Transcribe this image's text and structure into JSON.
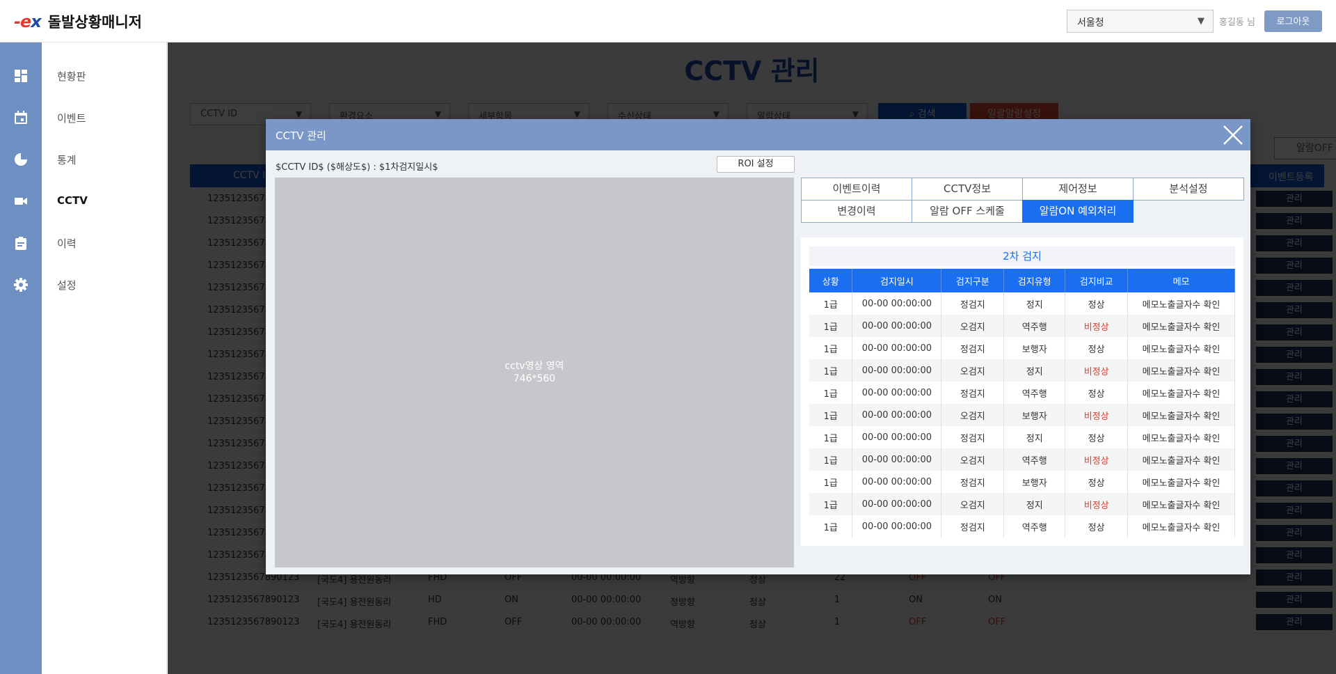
{
  "header": {
    "logo_mark": "ex",
    "app_title": "돌발상황매니저",
    "region_select": "서울청",
    "user_name": "홍길동 님",
    "logout_label": "로그아웃"
  },
  "sidebar": {
    "items": [
      {
        "label": "현황판",
        "icon": "dashboard-icon"
      },
      {
        "label": "이벤트",
        "icon": "calendar-icon"
      },
      {
        "label": "통계",
        "icon": "pie-chart-icon"
      },
      {
        "label": "CCTV",
        "icon": "video-camera-icon",
        "active": true
      },
      {
        "label": "이력",
        "icon": "clipboard-icon"
      },
      {
        "label": "설정",
        "icon": "gear-icon"
      }
    ]
  },
  "background_page": {
    "title": "CCTV 관리",
    "filters": [
      "CCTV ID",
      "환경요소",
      "세부항목",
      "수신상태",
      "알람상태"
    ],
    "search_label": "검색",
    "bulk_alarm_label": "일괄알람설정",
    "schedule_label": "알람OFF 스케줄",
    "table_headers": {
      "first": "CCTV ID",
      "last": "이벤트등록"
    },
    "rows_visible_prefix": "123512356789",
    "manage_label": "관리",
    "bottom_rows": [
      {
        "id": "1235123567890123",
        "location": "[국도4] 용전원동리",
        "res": "FHD",
        "rx": "OFF",
        "time": "00-00 00:00:00",
        "dir": "역방향",
        "status": "정상",
        "count": "22",
        "a1": "OFF",
        "a2": "OFF"
      },
      {
        "id": "1235123567890123",
        "location": "[국도4] 용전원동리",
        "res": "HD",
        "rx": "ON",
        "time": "00-00 00:00:00",
        "dir": "정방향",
        "status": "정상",
        "count": "1",
        "a1": "ON",
        "a2": "ON"
      },
      {
        "id": "1235123567890123",
        "location": "[국도4] 용전원동리",
        "res": "FHD",
        "rx": "OFF",
        "time": "00-00 00:00:00",
        "dir": "역방향",
        "status": "정상",
        "count": "1",
        "a1": "OFF",
        "a2": "OFF"
      }
    ]
  },
  "modal": {
    "title": "CCTV 관리",
    "camera_caption": "$CCTV ID$ ($해상도$) : $1차검지일시$",
    "roi_label": "ROI 설정",
    "video_label_line1": "cctv영상 영역",
    "video_label_line2": "746*560",
    "tabs": [
      {
        "label": "이벤트이력"
      },
      {
        "label": "CCTV정보"
      },
      {
        "label": "제어정보"
      },
      {
        "label": "분석설정"
      },
      {
        "label": "변경이력"
      },
      {
        "label": "알람 OFF 스케줄"
      },
      {
        "label": "알람ON 예외처리",
        "active": true
      }
    ],
    "panel_title": "2차 검지",
    "columns": [
      "상황",
      "검지일시",
      "검지구분",
      "검지유형",
      "검지비교",
      "메모"
    ],
    "rows": [
      [
        "1급",
        "00-00 00:00:00",
        "정검지",
        "정지",
        "정상",
        "메모노출글자수 확인"
      ],
      [
        "1급",
        "00-00 00:00:00",
        "오검지",
        "역주행",
        "비정상",
        "메모노출글자수 확인"
      ],
      [
        "1급",
        "00-00 00:00:00",
        "정검지",
        "보행자",
        "정상",
        "메모노출글자수 확인"
      ],
      [
        "1급",
        "00-00 00:00:00",
        "오검지",
        "정지",
        "비정상",
        "메모노출글자수 확인"
      ],
      [
        "1급",
        "00-00 00:00:00",
        "정검지",
        "역주행",
        "정상",
        "메모노출글자수 확인"
      ],
      [
        "1급",
        "00-00 00:00:00",
        "오검지",
        "보행자",
        "비정상",
        "메모노출글자수 확인"
      ],
      [
        "1급",
        "00-00 00:00:00",
        "정검지",
        "정지",
        "정상",
        "메모노출글자수 확인"
      ],
      [
        "1급",
        "00-00 00:00:00",
        "오검지",
        "역주행",
        "비정상",
        "메모노출글자수 확인"
      ],
      [
        "1급",
        "00-00 00:00:00",
        "정검지",
        "보행자",
        "정상",
        "메모노출글자수 확인"
      ],
      [
        "1급",
        "00-00 00:00:00",
        "오검지",
        "정지",
        "비정상",
        "메모노출글자수 확인"
      ],
      [
        "1급",
        "00-00 00:00:00",
        "정검지",
        "역주행",
        "정상",
        "메모노출글자수 확인"
      ]
    ]
  },
  "colors": {
    "primary_blue": "#1a6ef0",
    "modal_header": "#7a97c8",
    "sidebar_rail": "#6e8fc2",
    "alert_red": "#e53b2f"
  }
}
